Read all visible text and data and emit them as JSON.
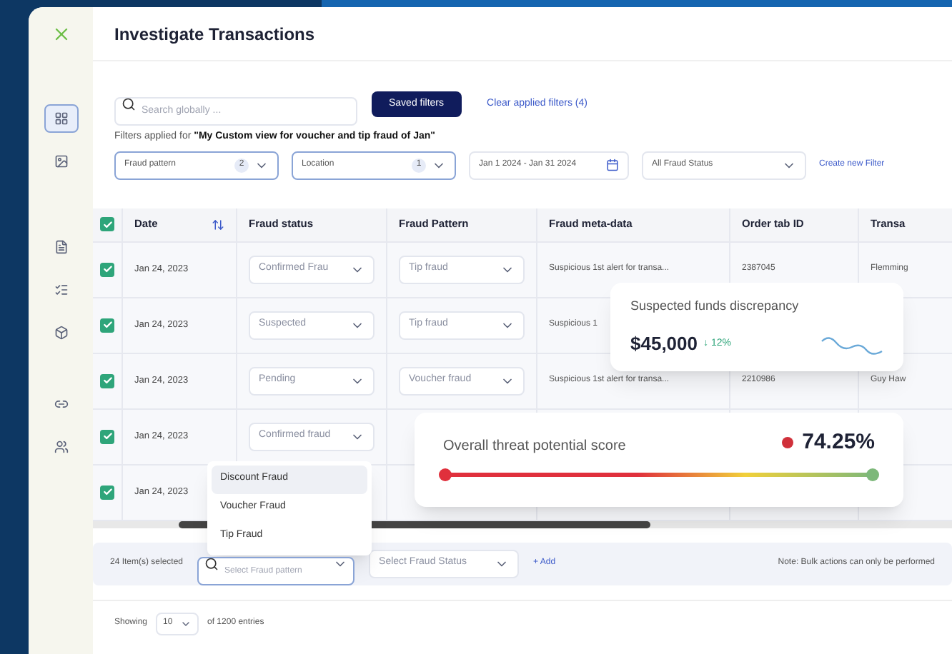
{
  "page": {
    "title": "Investigate Transactions"
  },
  "sidebar": {
    "items": [
      {
        "kind": "grid",
        "selected": true
      },
      {
        "kind": "image",
        "selected": false
      },
      {
        "kind": "doc",
        "selected": false
      },
      {
        "kind": "list",
        "selected": false
      },
      {
        "kind": "box",
        "selected": false
      },
      {
        "kind": "link",
        "selected": false
      },
      {
        "kind": "users",
        "selected": false
      }
    ]
  },
  "toolbar": {
    "search": {
      "placeholder": "Search globally ..."
    },
    "saved_button": "Saved filters",
    "clear_link": "Clear applied filters (4)"
  },
  "filters": {
    "label": "Filters applied for ",
    "view_name": "\"My Custom view for voucher and tip fraud of Jan\"",
    "items": [
      {
        "kind": "select",
        "value": "Fraud pattern",
        "count": "2"
      },
      {
        "kind": "select",
        "value": "Location",
        "count": "1"
      },
      {
        "kind": "date",
        "value": "Jan 1 2024 - Jan 31 2024"
      },
      {
        "kind": "select",
        "value": "All Fraud Status"
      }
    ],
    "create_link": "Create new Filter"
  },
  "table": {
    "all_checked": true,
    "columns": [
      "Date",
      "Fraud status",
      "Fraud Pattern",
      "Fraud meta-data",
      "Order tab ID",
      "Transa"
    ],
    "rows": [
      {
        "checked": true,
        "date": "Jan 24, 2023",
        "status": "Confirmed Frau",
        "pattern": "Tip fraud",
        "meta": "Suspicious 1st alert for transa...",
        "order": "2387045",
        "column_6": "Flemming"
      },
      {
        "checked": true,
        "date": "Jan 24, 2023",
        "status": "Suspected",
        "pattern": "Tip fraud",
        "meta": "Suspicious 1",
        "order": "",
        "column_6": ""
      },
      {
        "checked": true,
        "date": "Jan 24, 2023",
        "status": "Pending",
        "pattern": "Voucher fraud",
        "meta": "Suspicious 1st alert for transa...",
        "order": "2210986",
        "column_6": "Guy Haw"
      },
      {
        "checked": true,
        "date": "Jan 24, 2023",
        "status": "Confirmed fraud",
        "pattern": "",
        "meta": "",
        "order": "",
        "column_6": ""
      },
      {
        "checked": true,
        "date": "Jan 24, 2023",
        "status": "",
        "pattern": "",
        "meta": "",
        "order": "",
        "column_6": ""
      }
    ]
  },
  "dropdown_menu": {
    "items": [
      {
        "label": "Discount Fraud",
        "selected": true
      },
      {
        "label": "Voucher Fraud",
        "selected": false
      },
      {
        "label": "Tip Fraud",
        "selected": false
      }
    ]
  },
  "funds_card": {
    "title": "Suspected funds discrepancy",
    "amount": "$45,000",
    "change": "↓ 12%"
  },
  "threat_card": {
    "title": "Overall threat potential score",
    "score": "74.25%"
  },
  "bulk_bar": {
    "selected_text": "24 Item(s) selected",
    "pattern_placeholder": "Select Fraud pattern",
    "status_placeholder": "Select Fraud Status",
    "add_link": "+ Add",
    "note": "Note: Bulk actions can only be performed"
  },
  "footer": {
    "label": "Showing",
    "page_size": "10",
    "total": "of 1200 entries"
  }
}
